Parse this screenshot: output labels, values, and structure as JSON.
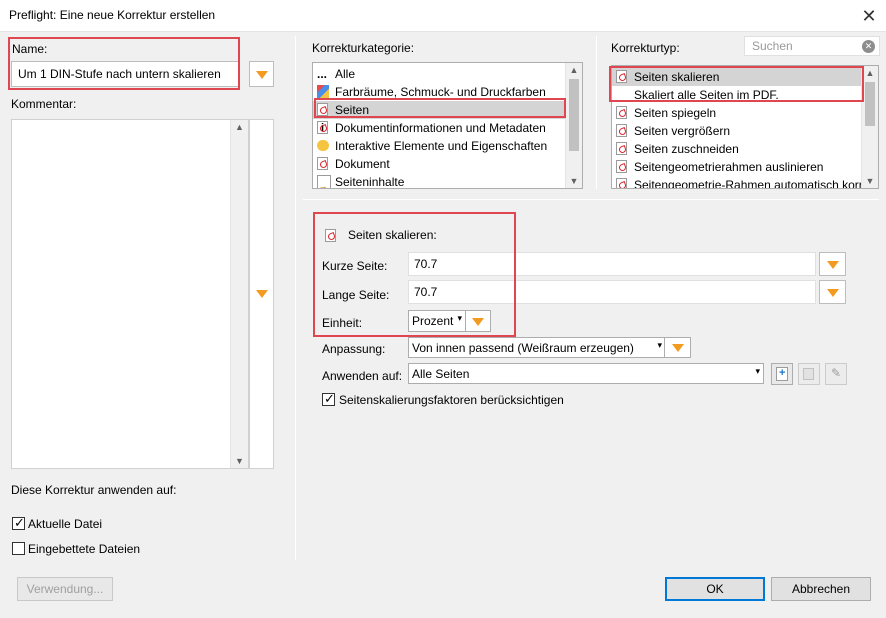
{
  "window": {
    "title": "Preflight: Eine neue Korrektur erstellen",
    "close": "✕"
  },
  "left": {
    "name_label": "Name:",
    "name_value": "Um 1 DIN-Stufe nach untern skalieren",
    "comment_label": "Kommentar:",
    "apply_label": "Diese Korrektur anwenden auf:",
    "cb_current": "Aktuelle Datei",
    "cb_embedded": "Eingebettete Dateien",
    "usage_button": "Verwendung..."
  },
  "category": {
    "label": "Korrekturkategorie:",
    "items": [
      {
        "label": "Alle",
        "icon": "dots-icon"
      },
      {
        "label": "Farbräume, Schmuck- und Druckfarben",
        "icon": "color-icon"
      },
      {
        "label": "Seiten",
        "icon": "pdf-icon"
      },
      {
        "label": "Dokumentinformationen und Metadaten",
        "icon": "info-icon"
      },
      {
        "label": "Interaktive Elemente und Eigenschaften",
        "icon": "comment-icon"
      },
      {
        "label": "Dokument",
        "icon": "document-icon"
      },
      {
        "label": "Seiteninhalte",
        "icon": "content-icon"
      }
    ]
  },
  "type": {
    "label": "Korrekturtyp:",
    "search_placeholder": "Suchen",
    "items": [
      {
        "label": "Seiten skalieren"
      },
      {
        "label": "Skaliert alle Seiten im PDF."
      },
      {
        "label": "Seiten spiegeln"
      },
      {
        "label": "Seiten vergrößern"
      },
      {
        "label": "Seiten zuschneiden"
      },
      {
        "label": "Seitengeometrierahmen auslinieren"
      },
      {
        "label": "Seitengeometrie-Rahmen automatisch korrig"
      }
    ]
  },
  "settings": {
    "header": "Seiten skalieren:",
    "short_label": "Kurze Seite:",
    "short_value": "70.7",
    "long_label": "Lange Seite:",
    "long_value": "70.7",
    "unit_label": "Einheit:",
    "unit_value": "Prozent",
    "fit_label": "Anpassung:",
    "fit_value": "Von innen passend (Weißraum erzeugen)",
    "apply_to_label": "Anwenden auf:",
    "apply_to_value": "Alle Seiten",
    "cb_factors": "Seitenskalierungsfaktoren berücksichtigen"
  },
  "buttons": {
    "ok": "OK",
    "cancel": "Abbrechen"
  },
  "colors": {
    "highlight": "#e0464f",
    "accent": "#f39a21",
    "selection": "#d4d4d4"
  }
}
